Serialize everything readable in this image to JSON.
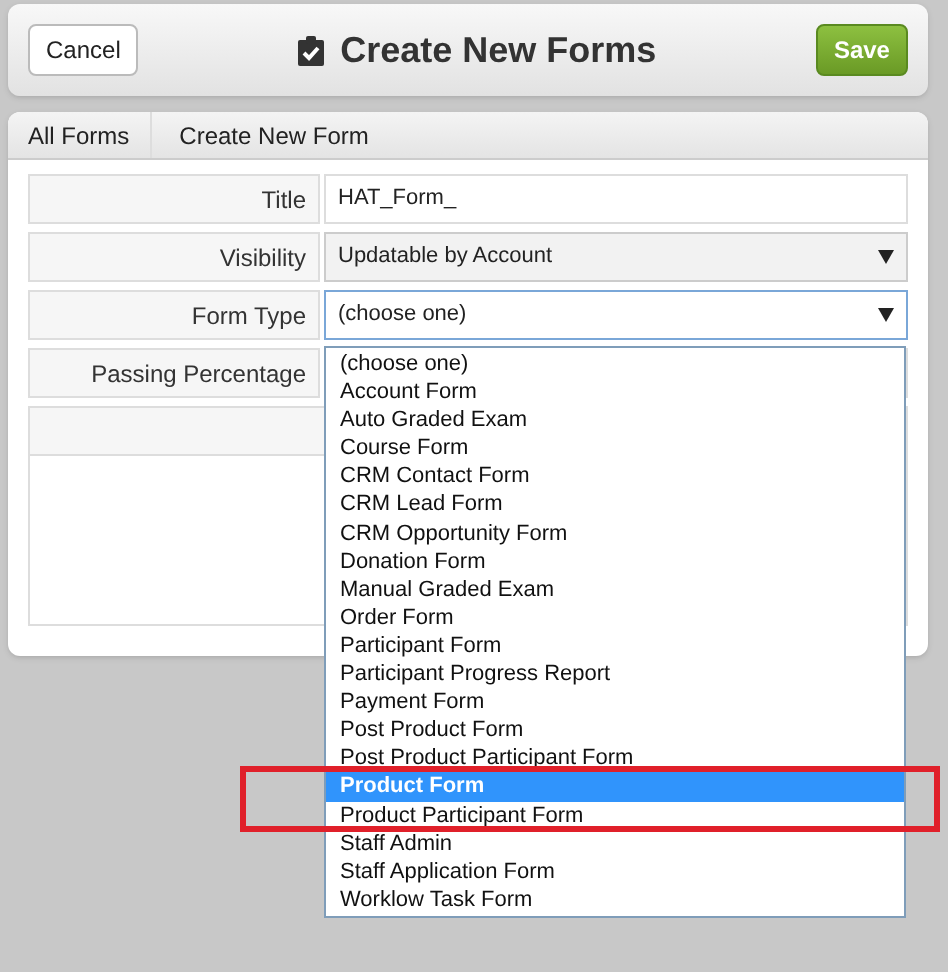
{
  "header": {
    "cancel": "Cancel",
    "title": "Create New Forms",
    "save": "Save"
  },
  "breadcrumb": [
    {
      "label": "All Forms"
    },
    {
      "label": "Create New Form"
    }
  ],
  "fields": [
    {
      "label": "Title",
      "kind": "text",
      "value": "HAT_Form_"
    },
    {
      "label": "Visibility",
      "kind": "select",
      "value": "Updatable by Account",
      "focused": false
    },
    {
      "label": "Form Type",
      "kind": "select",
      "value": "(choose one)",
      "focused": true
    },
    {
      "label": "Passing Percentage",
      "kind": "text"
    }
  ],
  "form_type_options": [
    {
      "label": "(choose one)",
      "selected": false
    },
    {
      "label": "Account Form",
      "selected": false
    },
    {
      "label": "Auto Graded Exam",
      "selected": false
    },
    {
      "label": "Course Form",
      "selected": false
    },
    {
      "label": "CRM Contact Form",
      "selected": false
    },
    {
      "label": "CRM Lead Form",
      "selected": false
    },
    {
      "label": "CRM Opportunity Form",
      "selected": false
    },
    {
      "label": "Donation Form",
      "selected": false
    },
    {
      "label": "Manual Graded Exam",
      "selected": false
    },
    {
      "label": "Order Form",
      "selected": false
    },
    {
      "label": "Participant Form",
      "selected": false
    },
    {
      "label": "Participant Progress Report",
      "selected": false
    },
    {
      "label": "Payment Form",
      "selected": false
    },
    {
      "label": "Post Product Form",
      "selected": false
    },
    {
      "label": "Post Product Participant Form",
      "selected": false
    },
    {
      "label": "Product Form",
      "selected": true
    },
    {
      "label": "Product Participant Form",
      "selected": false
    },
    {
      "label": "Staff Admin",
      "selected": false
    },
    {
      "label": "Staff Application Form",
      "selected": false
    },
    {
      "label": "Worklow Task Form",
      "selected": false
    }
  ]
}
